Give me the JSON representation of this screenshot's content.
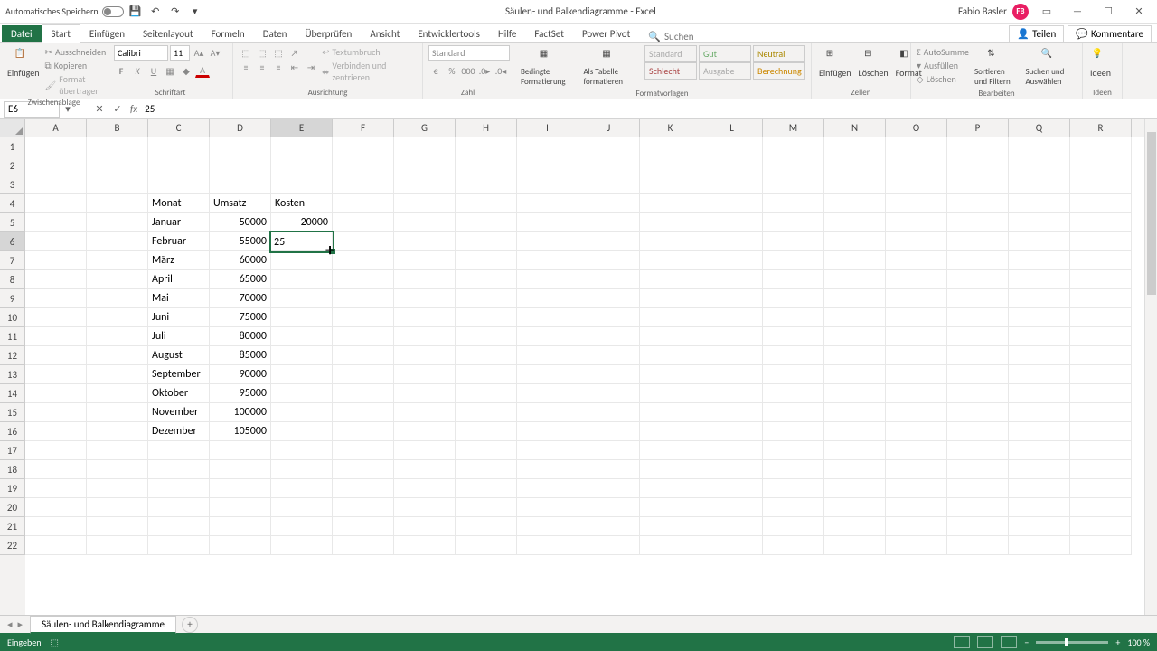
{
  "titlebar": {
    "autosave_label": "Automatisches Speichern",
    "doc_title": "Säulen- und Balkendiagramme - Excel",
    "user_name": "Fabio Basler",
    "user_initials": "FB"
  },
  "menutabs": {
    "file": "Datei",
    "tabs": [
      "Start",
      "Einfügen",
      "Seitenlayout",
      "Formeln",
      "Daten",
      "Überprüfen",
      "Ansicht",
      "Entwicklertools",
      "Hilfe",
      "FactSet",
      "Power Pivot"
    ],
    "active_index": 0,
    "search_placeholder": "Suchen",
    "share": "Teilen",
    "comments": "Kommentare"
  },
  "ribbon": {
    "clipboard": {
      "paste": "Einfügen",
      "cut": "Ausschneiden",
      "copy": "Kopieren",
      "format": "Format übertragen",
      "group": "Zwischenablage"
    },
    "font": {
      "name": "Calibri",
      "size": "11",
      "group": "Schriftart"
    },
    "alignment": {
      "wrap": "Textumbruch",
      "merge": "Verbinden und zentrieren",
      "group": "Ausrichtung"
    },
    "number": {
      "format": "Standard",
      "group": "Zahl"
    },
    "styles": {
      "cond": "Bedingte Formatierung",
      "table": "Als Tabelle formatieren",
      "s1": "Standard",
      "s2": "Gut",
      "s3": "Neutral",
      "s4": "Schlecht",
      "s5": "Ausgabe",
      "s6": "Berechnung",
      "group": "Formatvorlagen"
    },
    "cells": {
      "insert": "Einfügen",
      "delete": "Löschen",
      "format": "Format",
      "group": "Zellen"
    },
    "editing": {
      "autosum": "AutoSumme",
      "fill": "Ausfüllen",
      "clear": "Löschen",
      "sort": "Sortieren und Filtern",
      "find": "Suchen und Auswählen",
      "group": "Bearbeiten"
    },
    "ideas": {
      "label": "Ideen",
      "group": "Ideen"
    }
  },
  "formulabar": {
    "name_box": "E6",
    "value": "25"
  },
  "columns": [
    "A",
    "B",
    "C",
    "D",
    "E",
    "F",
    "G",
    "H",
    "I",
    "J",
    "K",
    "L",
    "M",
    "N",
    "O",
    "P",
    "Q",
    "R"
  ],
  "active_col": "E",
  "row_count": 22,
  "active_row": 6,
  "cells": {
    "C4": "Monat",
    "D4": "Umsatz",
    "E4": "Kosten",
    "C5": "Januar",
    "D5": "50000",
    "E5": "20000",
    "C6": "Februar",
    "D6": "55000",
    "C7": "März",
    "D7": "60000",
    "C8": "April",
    "D8": "65000",
    "C9": "Mai",
    "D9": "70000",
    "C10": "Juni",
    "D10": "75000",
    "C11": "Juli",
    "D11": "80000",
    "C12": "August",
    "D12": "85000",
    "C13": "September",
    "D13": "90000",
    "C14": "Oktober",
    "D14": "95000",
    "C15": "November",
    "D15": "100000",
    "C16": "Dezember",
    "D16": "105000"
  },
  "editing_cell": {
    "ref": "E6",
    "value": "25"
  },
  "chart_data": {
    "type": "table",
    "title": "Monat / Umsatz / Kosten",
    "categories": [
      "Januar",
      "Februar",
      "März",
      "April",
      "Mai",
      "Juni",
      "Juli",
      "August",
      "September",
      "Oktober",
      "November",
      "Dezember"
    ],
    "series": [
      {
        "name": "Umsatz",
        "values": [
          50000,
          55000,
          60000,
          65000,
          70000,
          75000,
          80000,
          85000,
          90000,
          95000,
          100000,
          105000
        ]
      },
      {
        "name": "Kosten",
        "values": [
          20000,
          null,
          null,
          null,
          null,
          null,
          null,
          null,
          null,
          null,
          null,
          null
        ]
      }
    ]
  },
  "sheettabs": {
    "active": "Säulen- und Balkendiagramme"
  },
  "statusbar": {
    "mode": "Eingeben",
    "zoom": "100 %"
  }
}
